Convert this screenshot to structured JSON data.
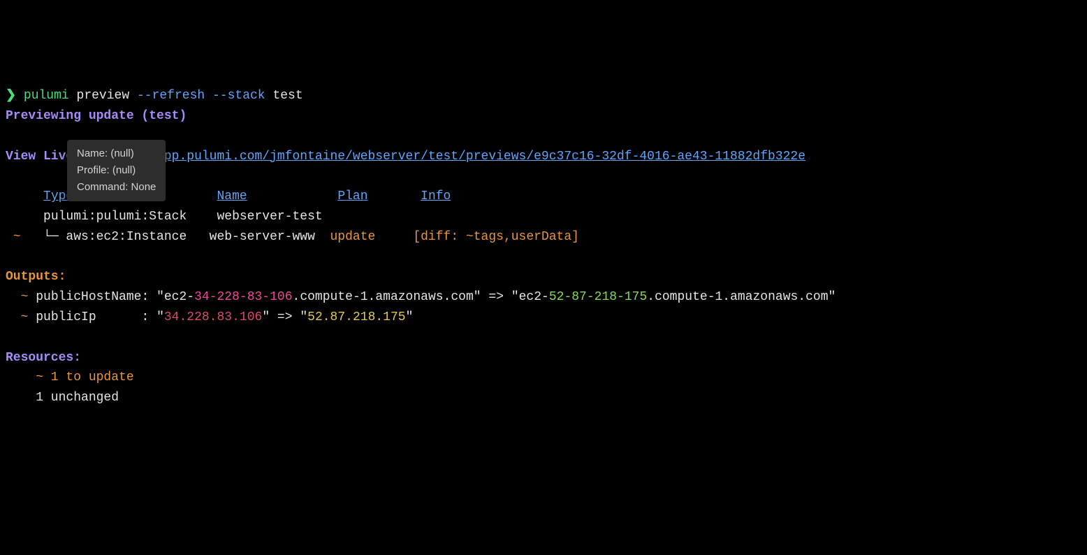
{
  "prompt": {
    "symbol": "❯",
    "command": "pulumi",
    "subcommand": "preview",
    "flag1": "--refresh",
    "flag2": "--stack",
    "stack_arg": "test"
  },
  "preview_header": "Previewing update (test)",
  "view_live": {
    "label": "View Live:",
    "url": "https://app.pulumi.com/jmfontaine/webserver/test/previews/e9c37c16-32df-4016-ae43-11882dfb322e"
  },
  "table": {
    "headers": {
      "type": "Type",
      "name": "Name",
      "plan": "Plan",
      "info": "Info"
    },
    "rows": [
      {
        "marker": "   ",
        "type": "pulumi:pulumi:Stack",
        "name": "webserver-test",
        "plan": "",
        "info": ""
      },
      {
        "marker": " ~ ",
        "type": "└─ aws:ec2:Instance",
        "name": "web-server-www",
        "plan": "update",
        "info": "[diff: ~tags,userData]"
      }
    ]
  },
  "outputs": {
    "header": "Outputs:",
    "items": [
      {
        "marker": "  ~ ",
        "key": "publicHostName",
        "sep": ": ",
        "q": "\"",
        "old_prefix": "ec2-",
        "old_ip": "34-228-83-106",
        "old_suffix": ".compute-1.amazonaws.com",
        "arrow": " => ",
        "new_prefix": "ec2-",
        "new_ip": "52-87-218-175",
        "new_suffix": ".compute-1.amazonaws.com"
      },
      {
        "marker": "  ~ ",
        "key": "publicIp      ",
        "sep": ": ",
        "q": "\"",
        "old_ip": "34.228.83.106",
        "arrow": " => ",
        "new_ip": "52.87.218.175"
      }
    ]
  },
  "resources": {
    "header": "Resources:",
    "update_line": "    ~ 1 to update",
    "unchanged_line": "    1 unchanged"
  },
  "tooltip": {
    "line1": "Name: (null)",
    "line2": "Profile: (null)",
    "line3": "Command: None"
  }
}
